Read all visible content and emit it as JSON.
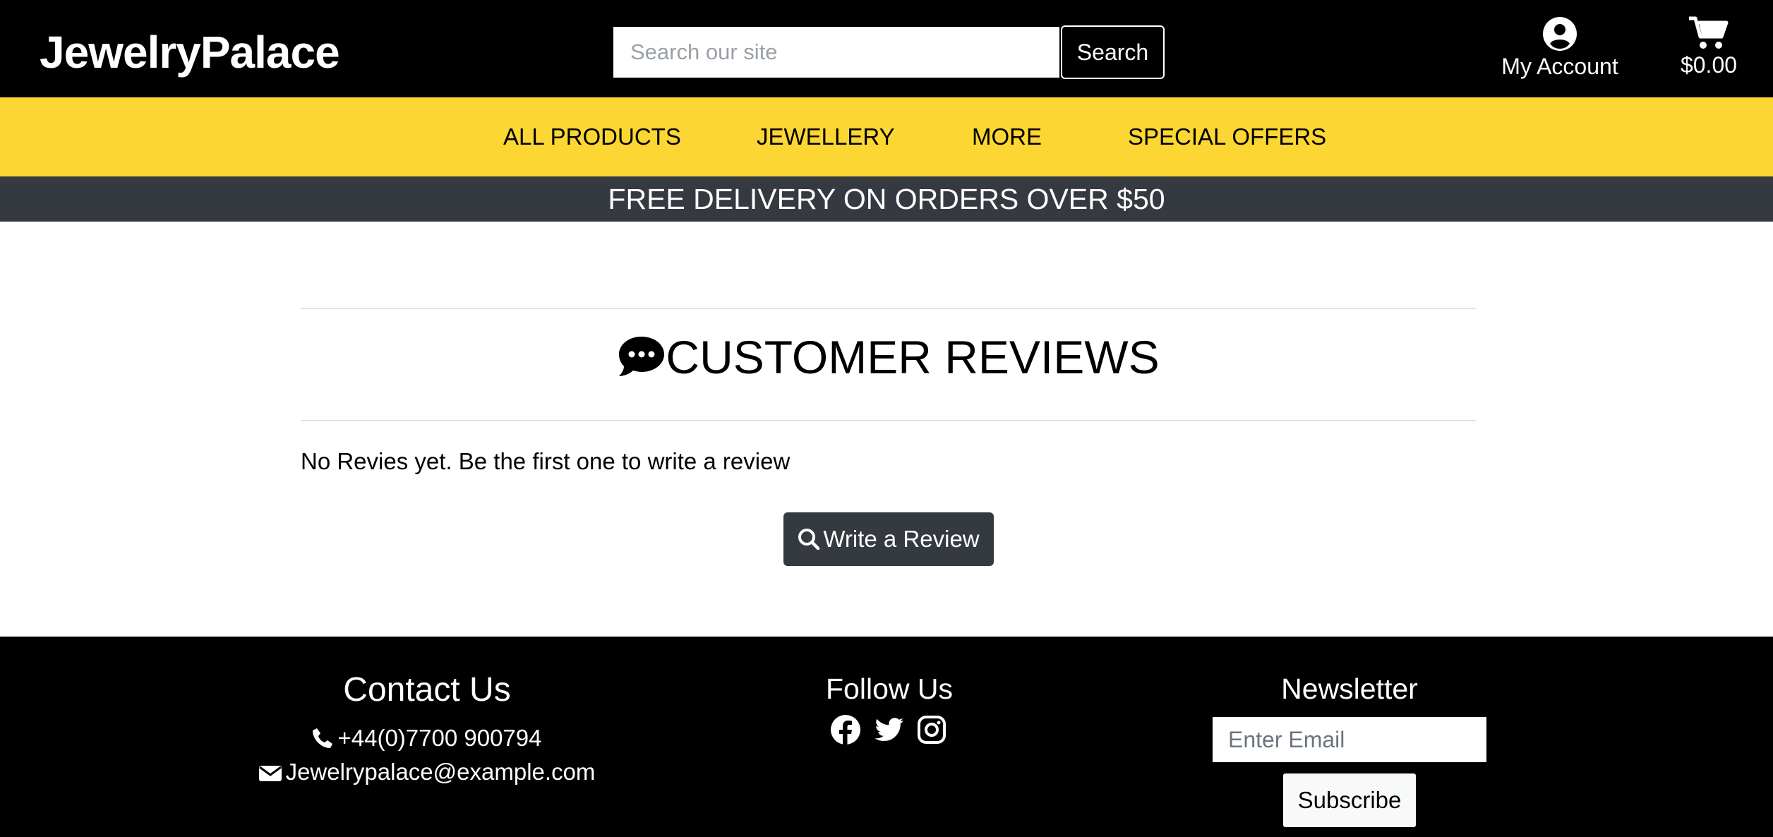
{
  "header": {
    "logo": "JewelryPalace",
    "search_placeholder": "Search our site",
    "search_button": "Search",
    "account_label": "My Account",
    "cart_total": "$0.00"
  },
  "nav": {
    "items": [
      "ALL PRODUCTS",
      "JEWELLERY",
      "MORE",
      "SPECIAL OFFERS"
    ]
  },
  "banner": {
    "text": "FREE DELIVERY ON ORDERS OVER $50"
  },
  "reviews": {
    "title": "CUSTOMER REVIEWS",
    "empty_message": "No Revies yet. Be the first one to write a review",
    "write_button": "Write a Review"
  },
  "footer": {
    "contact": {
      "title": "Contact Us",
      "phone": "+44(0)7700 900794",
      "email": "Jewelrypalace@example.com"
    },
    "follow": {
      "title": "Follow Us",
      "icons": [
        "facebook-icon",
        "twitter-icon",
        "instagram-icon"
      ]
    },
    "newsletter": {
      "title": "Newsletter",
      "email_placeholder": "Enter Email",
      "subscribe_button": "Subscribe"
    }
  },
  "colors": {
    "header_bg": "#000000",
    "nav_bg": "#fcd733",
    "banner_bg": "#343a40",
    "button_dark": "#343a40",
    "footer_bg": "#000000"
  }
}
